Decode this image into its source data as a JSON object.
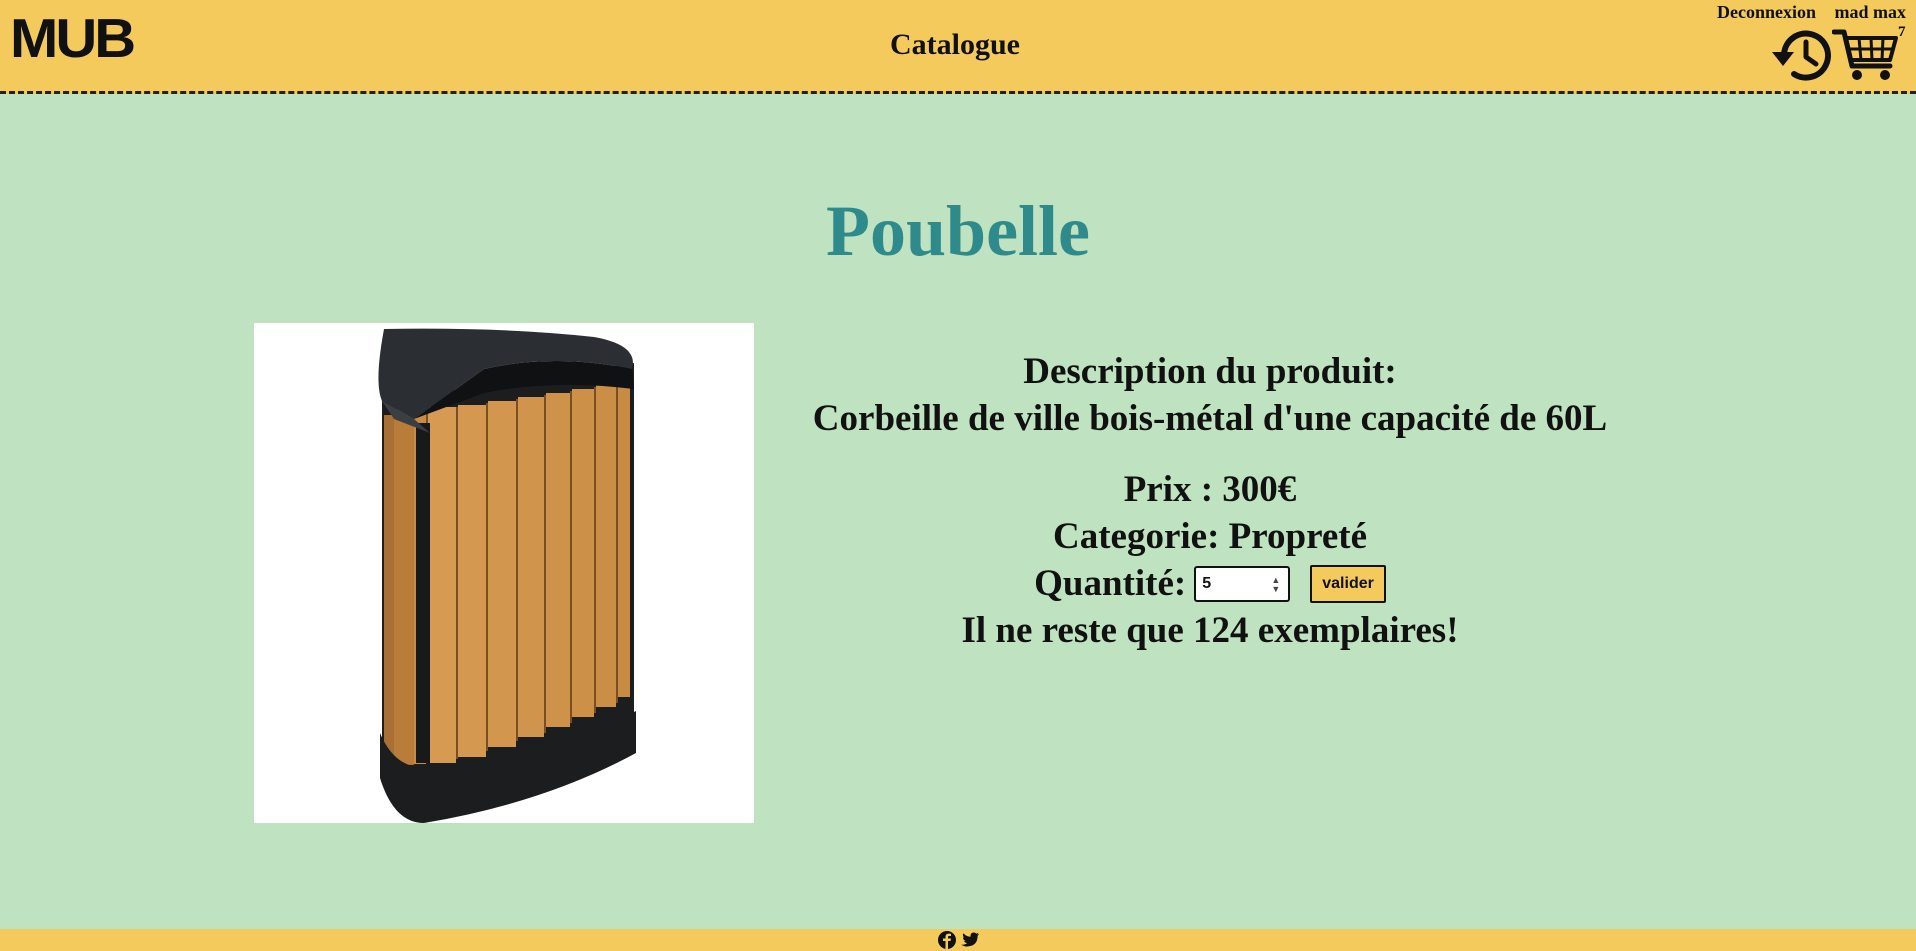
{
  "header": {
    "logo": "MUB",
    "nav_catalogue": "Catalogue",
    "logout": "Deconnexion",
    "username": "mad max",
    "cart_count": "7"
  },
  "product": {
    "name": "Poubelle",
    "description_label": "Description du produit:",
    "description": "Corbeille de ville bois-métal d'une capacité de 60L",
    "price_text": "Prix : 300€",
    "category_text": "Categorie: Propreté",
    "quantity_label": "Quantité:",
    "quantity_value": "5",
    "submit_label": "valider",
    "stock_text": "Il ne reste que 124 exemplaires!"
  },
  "icons": {
    "history": "history-icon",
    "cart": "cart-icon",
    "facebook": "facebook-icon",
    "twitter": "twitter-icon"
  },
  "colors": {
    "header_bg": "#f5ca5c",
    "page_bg": "#bfe3c0",
    "title": "#2f8a8c"
  }
}
